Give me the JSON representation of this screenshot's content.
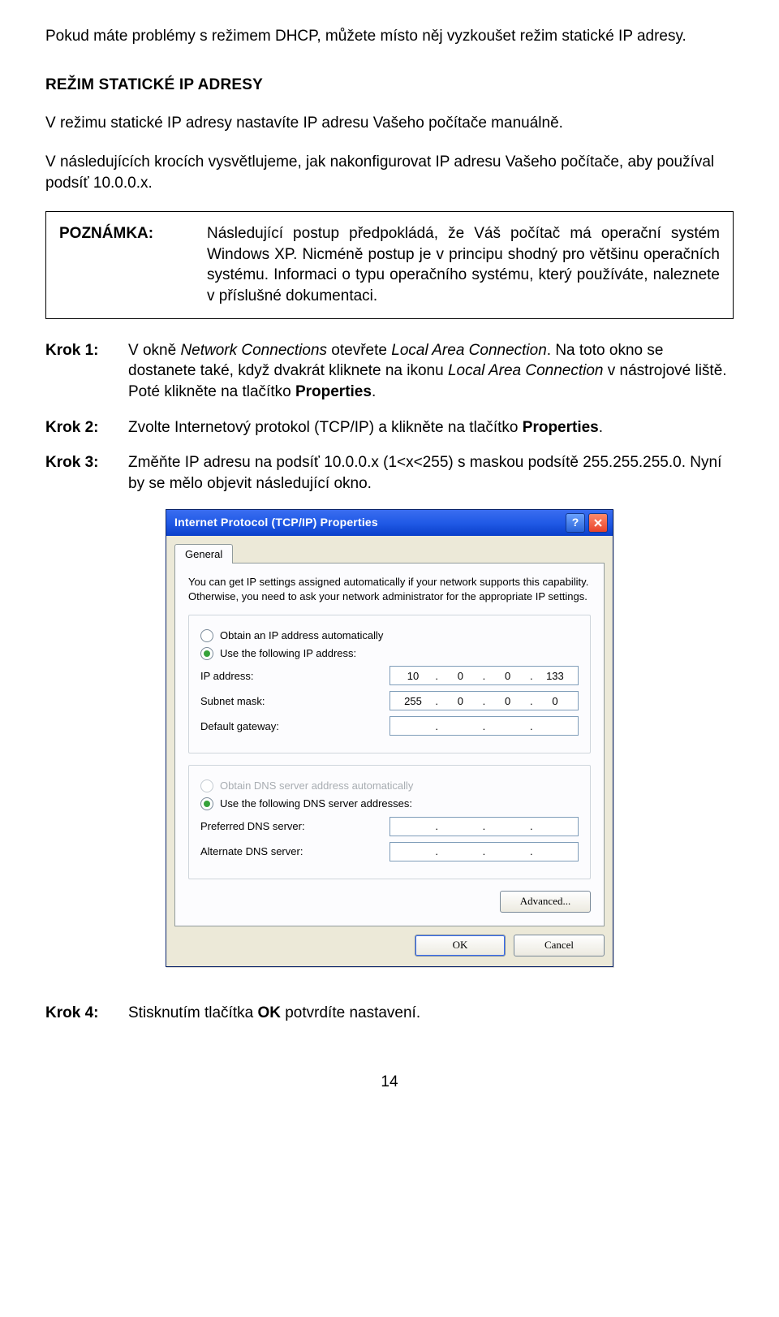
{
  "para1": "Pokud máte problémy s režimem DHCP, můžete místo něj vyzkoušet režim statické IP adresy.",
  "heading": "REŽIM STATICKÉ IP ADRESY",
  "para2": "V režimu statické IP adresy nastavíte IP adresu Vašeho počítače manuálně.",
  "para3": "V následujících krocích vysvětlujeme, jak nakonfigurovat IP adresu Vašeho počítače, aby používal podsíť 10.0.0.x.",
  "note_label": "POZNÁMKA:",
  "note_text": "Následující postup předpokládá, že Váš počítač má operační systém Windows XP. Nicméně postup je v principu shodný pro většinu operačních systému. Informaci o typu operačního systému, který používáte, naleznete v příslušné dokumentaci.",
  "steps": {
    "s1_label": "Krok 1:",
    "s1_a": "V okně ",
    "s1_i1": "Network Connections",
    "s1_b": " otevřete ",
    "s1_i2": "Local Area Connection",
    "s1_c": ". Na toto okno se dostanete také, když dvakrát kliknete na ikonu ",
    "s1_i3": "Local Area Connection",
    "s1_d": " v nástrojové liště. Poté klikněte na tlačítko ",
    "s1_b1": "Properties",
    "s1_e": ".",
    "s2_label": "Krok 2:",
    "s2_a": "Zvolte Internetový protokol (TCP/IP) a klikněte na tlačítko ",
    "s2_b1": "Properties",
    "s2_b": ".",
    "s3_label": "Krok 3:",
    "s3_a": "Změňte IP adresu na podsíť 10.0.0.x (1<x<255) s maskou podsítě 255.255.255.0. Nyní by se mělo objevit následující okno.",
    "s4_label": "Krok 4:",
    "s4_a": "Stisknutím tlačítka ",
    "s4_b1": "OK",
    "s4_b": " potvrdíte nastavení."
  },
  "dlg": {
    "title": "Internet Protocol (TCP/IP) Properties",
    "tab": "General",
    "intro": "You can get IP settings assigned automatically if your network supports this capability. Otherwise, you need to ask your network administrator for the appropriate IP settings.",
    "r_auto_ip": "Obtain an IP address automatically",
    "r_use_ip": "Use the following IP address:",
    "ip_label": "IP address:",
    "ip": [
      "10",
      "0",
      "0",
      "133"
    ],
    "mask_label": "Subnet mask:",
    "mask": [
      "255",
      "0",
      "0",
      "0"
    ],
    "gw_label": "Default gateway:",
    "r_auto_dns": "Obtain DNS server address automatically",
    "r_use_dns": "Use the following DNS server addresses:",
    "pdns_label": "Preferred DNS server:",
    "adns_label": "Alternate DNS server:",
    "advanced": "Advanced...",
    "ok": "OK",
    "cancel": "Cancel"
  },
  "page_number": "14"
}
